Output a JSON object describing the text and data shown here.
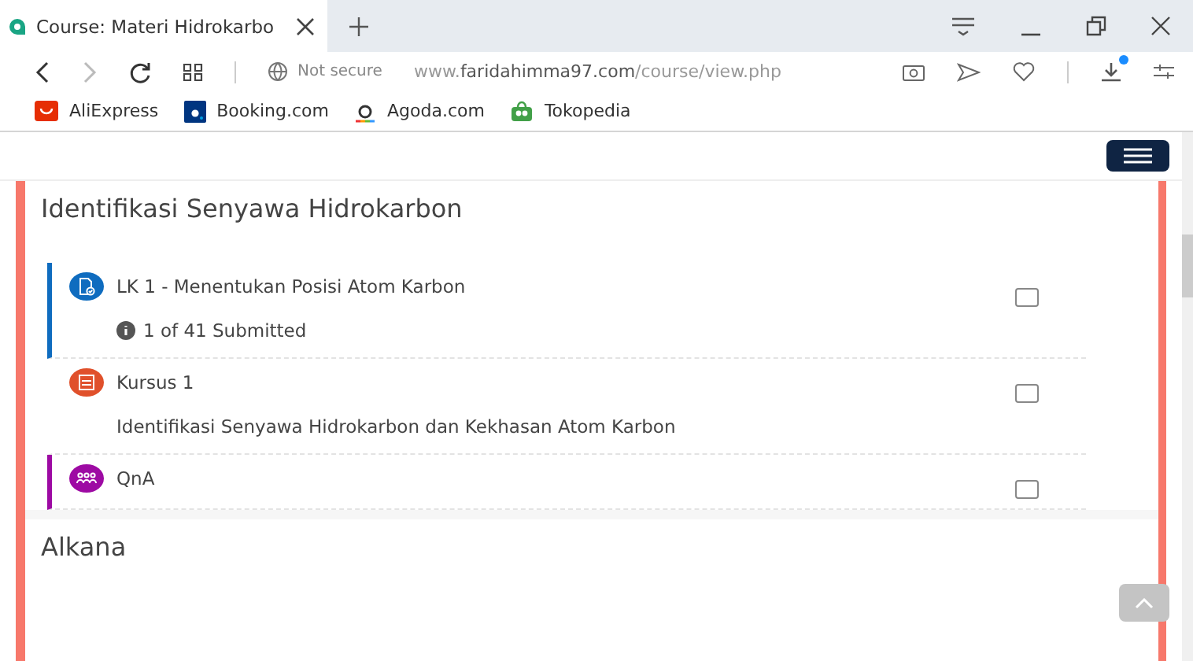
{
  "tab": {
    "title": "Course: Materi Hidrokarbo",
    "selected": true
  },
  "address": {
    "security": "Not secure",
    "url_prefix": "www.",
    "url_host": "faridahimma97.com",
    "url_path": "/course/view.php",
    "download_badge": true
  },
  "bookmarks": [
    {
      "label": "AliExpress",
      "kind": "aliexpress"
    },
    {
      "label": "Booking.com",
      "kind": "booking"
    },
    {
      "label": "Agoda.com",
      "kind": "agoda"
    },
    {
      "label": "Tokopedia",
      "kind": "tokopedia"
    }
  ],
  "sections": [
    {
      "title": "Identifikasi Senyawa Hidrokarbon",
      "activities": [
        {
          "kind": "assign",
          "name": "LK 1 - Menentukan Posisi Atom Karbon",
          "info": "1 of 41 Submitted",
          "color": "#0f6cbf",
          "marked": true,
          "checked": false
        },
        {
          "kind": "page",
          "name": "Kursus 1",
          "description": "Identifikasi Senyawa Hidrokarbon dan Kekhasan Atom Karbon",
          "color": "#e0502b",
          "marked": false,
          "checked": false
        },
        {
          "kind": "forum",
          "name": "QnA",
          "color": "#9d0aa3",
          "marked": true,
          "checked": false
        }
      ]
    },
    {
      "title": "Alkana"
    }
  ]
}
